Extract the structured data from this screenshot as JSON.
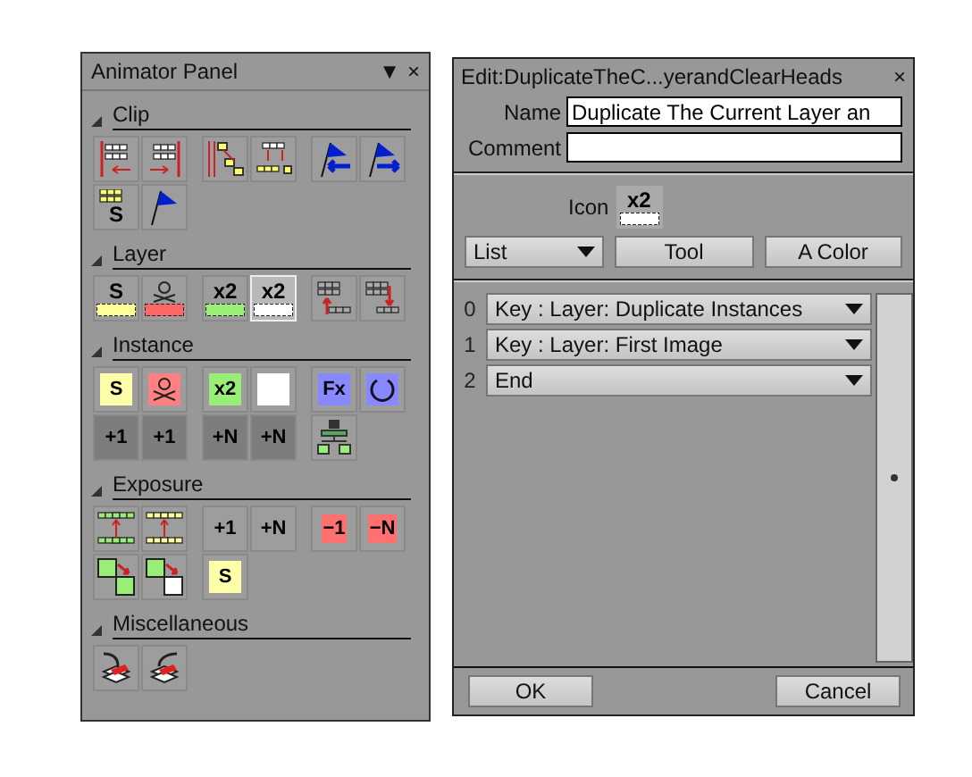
{
  "animator_panel": {
    "title": "Animator Panel",
    "menu_glyph": "▼",
    "close_glyph": "×",
    "sections": [
      {
        "title": "Clip",
        "expanded": true,
        "rows": [
          [
            [
              {
                "kind": "frames-left",
                "selected": false
              },
              {
                "kind": "frames-right",
                "selected": false
              }
            ],
            [
              {
                "kind": "move-frames",
                "selected": false
              },
              {
                "kind": "drop-frames",
                "selected": false
              }
            ],
            [
              {
                "kind": "flag-left",
                "selected": false
              },
              {
                "kind": "flag-right",
                "selected": false
              }
            ]
          ],
          [
            [
              {
                "kind": "stack",
                "text": "S",
                "selected": false
              },
              {
                "kind": "flag",
                "selected": false
              }
            ]
          ]
        ]
      },
      {
        "title": "Layer",
        "expanded": true,
        "rows": [
          [
            [
              {
                "kind": "layer",
                "text": "S",
                "color": "#ffff99",
                "selected": false
              },
              {
                "kind": "layer-skull",
                "color": "#ff6666",
                "selected": false
              }
            ],
            [
              {
                "kind": "layer",
                "text": "x2",
                "color": "#99ee77",
                "selected": false
              },
              {
                "kind": "layer",
                "text": "x2",
                "color": "#ffffff",
                "selected": true
              }
            ],
            [
              {
                "kind": "frames-up",
                "selected": false
              },
              {
                "kind": "frames-down",
                "selected": false
              }
            ]
          ]
        ]
      },
      {
        "title": "Instance",
        "expanded": true,
        "rows": [
          [
            [
              {
                "kind": "tile",
                "text": "S",
                "color": "#ffffaa",
                "selected": false
              },
              {
                "kind": "tile-skull",
                "color": "#ff8080",
                "selected": false
              }
            ],
            [
              {
                "kind": "tile",
                "text": "x2",
                "color": "#99ee77",
                "selected": false
              },
              {
                "kind": "tile",
                "text": "",
                "color": "#ffffff",
                "selected": false
              }
            ],
            [
              {
                "kind": "tile",
                "text": "Fx",
                "color": "#8888ff",
                "selected": false
              },
              {
                "kind": "tile-rotate",
                "color": "#8888ff",
                "selected": false
              }
            ]
          ],
          [
            [
              {
                "kind": "bracket-left",
                "text": "+1",
                "selected": false
              },
              {
                "kind": "bracket-right",
                "text": "+1",
                "selected": false
              }
            ],
            [
              {
                "kind": "bracket-left",
                "text": "+N",
                "selected": false
              },
              {
                "kind": "bracket-right",
                "text": "+N",
                "selected": false
              }
            ],
            [
              {
                "kind": "tree",
                "selected": false
              }
            ]
          ]
        ]
      },
      {
        "title": "Exposure",
        "expanded": true,
        "rows": [
          [
            [
              {
                "kind": "expose",
                "color": "#99ee77",
                "selected": false
              },
              {
                "kind": "expose",
                "color": "#ffff99",
                "selected": false
              }
            ],
            [
              {
                "kind": "label",
                "text": "+1",
                "selected": false
              },
              {
                "kind": "label",
                "text": "+N",
                "selected": false
              }
            ],
            [
              {
                "kind": "label",
                "text": "−1",
                "color": "#ff7070",
                "selected": false
              },
              {
                "kind": "label",
                "text": "−N",
                "color": "#ff7070",
                "selected": false
              }
            ]
          ],
          [
            [
              {
                "kind": "copy",
                "color": "#99ee77",
                "selected": false
              },
              {
                "kind": "copy",
                "color": "#ffffff",
                "selected": false
              }
            ],
            [
              {
                "kind": "tile",
                "text": "S",
                "color": "#ffffaa",
                "selected": false
              }
            ]
          ]
        ]
      },
      {
        "title": "Miscellaneous",
        "expanded": true,
        "rows": [
          [
            [
              {
                "kind": "paint-in",
                "selected": false
              },
              {
                "kind": "paint-out",
                "selected": false
              }
            ]
          ]
        ]
      }
    ]
  },
  "edit_dialog": {
    "title": "Edit:DuplicateTheC...yerandClearHeads",
    "close_glyph": "×",
    "name_label": "Name",
    "name_value": "Duplicate The Current Layer an",
    "comment_label": "Comment",
    "icon_label": "Icon",
    "icon": {
      "kind": "layer",
      "text": "x2",
      "color": "#ffffff"
    },
    "list_dropdown": "List",
    "tool_button": "Tool",
    "color_button": "A Color",
    "steps": [
      {
        "index": "0",
        "value": "Key : Layer: Duplicate Instances"
      },
      {
        "index": "1",
        "value": "Key : Layer: First Image"
      },
      {
        "index": "2",
        "value": "End"
      }
    ],
    "buttons": [
      "OK",
      "Cancel"
    ]
  }
}
